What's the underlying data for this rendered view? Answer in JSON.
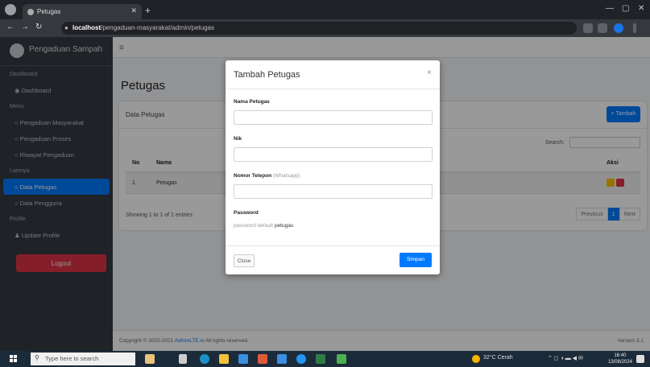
{
  "browser": {
    "tab_title": "Petugas",
    "url_host": "localhost",
    "url_path": "/pengaduan-masyarakat/admin/petugas"
  },
  "sidebar": {
    "brand": "Pengaduan Sampah",
    "header_dashboard": "Dashboard",
    "dashboard": "Dashboard",
    "header_menu": "Menu",
    "menu_items": [
      "Pengaduan Masyarakat",
      "Pengaduan Proses",
      "Riwayat Pengaduan"
    ],
    "header_data": "Lainnya",
    "data_items": [
      "Data Petugas",
      "Data Pengguna"
    ],
    "header_profile": "Profile",
    "profile": "Update Profile",
    "logout": "Logout"
  },
  "page": {
    "title": "Petugas",
    "card_title": "Data Petugas",
    "add_button": "+ Tambah",
    "search_label": "Search:",
    "columns": [
      "No",
      "Nama",
      "",
      "Aksi"
    ],
    "rows": [
      {
        "no": "1",
        "nama": "Petugas"
      }
    ],
    "info": "Showing 1 to 1 of 1 entries",
    "prev": "Previous",
    "page_num": "1",
    "next": "Next"
  },
  "footer": {
    "copyright": "Copyright © 2020-2021",
    "brand_link": "AdminLTE.io",
    "rights": "All rights reserved.",
    "version": "Version 3.1"
  },
  "modal": {
    "title": "Tambah Petugas",
    "close_icon": "×",
    "label_nama": "Nama Petugas",
    "label_nik": "Nik",
    "label_telepon": "Nomor Telepon",
    "telepon_hint": "(Whatsapp)",
    "label_password": "Password",
    "password_note": "password default",
    "password_value": "petugas",
    "btn_close": "Close",
    "btn_save": "Simpan"
  },
  "taskbar": {
    "search_placeholder": "Type here to search",
    "weather": "32°C Cerah",
    "time": "16:40",
    "date": "13/08/2024"
  },
  "colors": {
    "sidebar_bg": "#343a40",
    "primary": "#007bff",
    "danger": "#dc3545",
    "warning": "#ffc107"
  }
}
